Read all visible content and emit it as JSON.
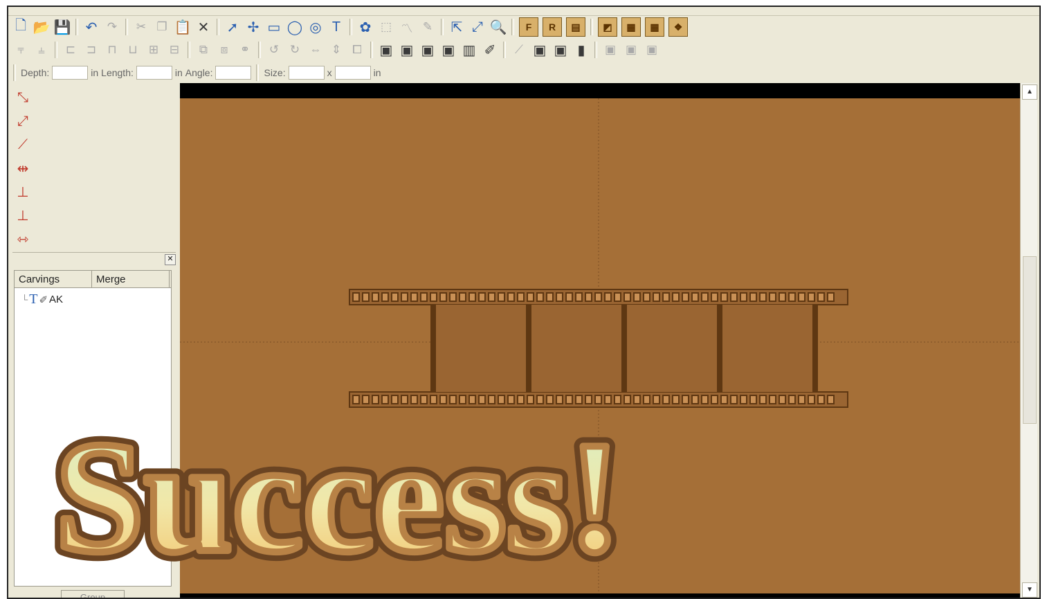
{
  "toolbar": {
    "row1": [
      {
        "name": "new-file-icon",
        "glyph": "🗋"
      },
      {
        "name": "open-folder-icon",
        "glyph": "📂"
      },
      {
        "name": "save-icon",
        "glyph": "💾"
      },
      {
        "sep": true
      },
      {
        "name": "undo-icon",
        "glyph": "↶"
      },
      {
        "name": "redo-icon",
        "glyph": "↷",
        "dim": true
      },
      {
        "sep": true
      },
      {
        "name": "cut-icon",
        "glyph": "✂",
        "dim": true
      },
      {
        "name": "copy-icon",
        "glyph": "❐",
        "dim": true
      },
      {
        "name": "paste-icon",
        "glyph": "📋",
        "dark": true
      },
      {
        "name": "delete-icon",
        "glyph": "✕",
        "dark": true
      },
      {
        "sep": true
      },
      {
        "name": "select-arrow-icon",
        "glyph": "➚"
      },
      {
        "name": "node-edit-icon",
        "glyph": "✢"
      },
      {
        "name": "rectangle-icon",
        "glyph": "▭"
      },
      {
        "name": "circle-icon",
        "glyph": "◯"
      },
      {
        "name": "spiral-icon",
        "glyph": "◎"
      },
      {
        "name": "text-tool-icon",
        "glyph": "T"
      },
      {
        "sep": true
      },
      {
        "name": "shell-icon",
        "glyph": "✿"
      },
      {
        "name": "shape-icon",
        "glyph": "⬚",
        "dim": true
      },
      {
        "name": "wave-shape-icon",
        "glyph": "〽",
        "dim": true
      },
      {
        "name": "pen-icon",
        "glyph": "✎",
        "dim": true
      },
      {
        "sep": true
      },
      {
        "name": "pointer-icon",
        "glyph": "⇱"
      },
      {
        "name": "zoom-fit-icon",
        "glyph": "⤢"
      },
      {
        "name": "zoom-icon",
        "glyph": "🔍"
      },
      {
        "sep": true
      },
      {
        "name": "front-view-icon",
        "glyph": "F",
        "boxed": true
      },
      {
        "name": "rear-view-icon",
        "glyph": "R",
        "boxed": true
      },
      {
        "name": "frame-icon",
        "glyph": "▤",
        "boxed": true
      },
      {
        "sep": true
      },
      {
        "name": "material-icon",
        "glyph": "◩",
        "boxed": true
      },
      {
        "name": "grid-icon",
        "glyph": "▦",
        "boxed": true
      },
      {
        "name": "grid-wood-icon",
        "glyph": "▦",
        "boxed": true
      },
      {
        "name": "texture-icon",
        "glyph": "❖",
        "boxed": true
      }
    ],
    "row2": [
      {
        "name": "align-top-icon",
        "glyph": "⫧",
        "dim": true
      },
      {
        "name": "align-bottom-icon",
        "glyph": "⫨",
        "dim": true
      },
      {
        "sep": true
      },
      {
        "name": "align-left-icon",
        "glyph": "⊏",
        "dim": true
      },
      {
        "name": "align-right-icon",
        "glyph": "⊐",
        "dim": true
      },
      {
        "name": "align-center-icon",
        "glyph": "⊓",
        "dim": true
      },
      {
        "name": "align-middle-icon",
        "glyph": "⊔",
        "dim": true
      },
      {
        "name": "distribute-h-icon",
        "glyph": "⊞",
        "dim": true
      },
      {
        "name": "distribute-v-icon",
        "glyph": "⊟",
        "dim": true
      },
      {
        "sep": true
      },
      {
        "name": "group-icon",
        "glyph": "⧉",
        "dim": true
      },
      {
        "name": "ungroup-icon",
        "glyph": "⧈",
        "dim": true
      },
      {
        "name": "link-icon",
        "glyph": "⚭",
        "dim": true
      },
      {
        "sep": true
      },
      {
        "name": "rotate-left-icon",
        "glyph": "↺",
        "dim": true
      },
      {
        "name": "rotate-right-icon",
        "glyph": "↻",
        "dim": true
      },
      {
        "name": "mirror-icon",
        "glyph": "⇔",
        "dim": true
      },
      {
        "name": "flip-icon",
        "glyph": "⇕",
        "dim": true
      },
      {
        "name": "combine-icon",
        "glyph": "⧠",
        "dim": true
      },
      {
        "sep": true
      },
      {
        "name": "bit-1-icon",
        "glyph": "▣",
        "dark": true
      },
      {
        "name": "bit-2-icon",
        "glyph": "▣",
        "dark": true
      },
      {
        "name": "bit-3-icon",
        "glyph": "▣",
        "dark": true
      },
      {
        "name": "bit-4-icon",
        "glyph": "▣",
        "dark": true
      },
      {
        "name": "bit-5-icon",
        "glyph": "▥",
        "dark": true
      },
      {
        "name": "brush-icon",
        "glyph": "✐",
        "dark": true
      },
      {
        "sep": true
      },
      {
        "name": "knife-icon",
        "glyph": "⟋",
        "dim": true
      },
      {
        "name": "bit-6-icon",
        "glyph": "▣",
        "dark": true
      },
      {
        "name": "bit-7-icon",
        "glyph": "▣",
        "dark": true
      },
      {
        "name": "bit-8-icon",
        "glyph": "▮",
        "dark": true
      },
      {
        "sep": true
      },
      {
        "name": "bit-9-icon",
        "glyph": "▣",
        "dim": true
      },
      {
        "name": "bit-10-icon",
        "glyph": "▣",
        "dim": true
      },
      {
        "name": "bit-11-icon",
        "glyph": "▣",
        "dim": true
      }
    ]
  },
  "fields": {
    "depth_label": "Depth:",
    "depth_unit": "in",
    "length_label": "Length:",
    "length_unit": "in",
    "angle_label": "Angle:",
    "size_label": "Size:",
    "size_separator": "x",
    "size_unit": "in"
  },
  "left_tools": [
    {
      "name": "select-node-icon",
      "glyph": "⤡"
    },
    {
      "name": "move-node-icon",
      "glyph": "⤢"
    },
    {
      "name": "draw-line-icon",
      "glyph": "⟋"
    },
    {
      "name": "transform-icon",
      "glyph": "⇹"
    },
    {
      "name": "add-point-icon",
      "glyph": "⊥"
    },
    {
      "name": "remove-point-icon",
      "glyph": "⊥"
    },
    {
      "name": "distribute-points-icon",
      "glyph": "⇿"
    }
  ],
  "panel": {
    "close_glyph": "✕",
    "tab_carvings": "Carvings",
    "tab_merge": "Merge",
    "tree_item_label": "AK",
    "group_button": "Group"
  },
  "overlay": {
    "text": "Success!"
  },
  "colors": {
    "wood": "#a56f37",
    "carving_face": "#9a6532",
    "carving_shadow": "#5e3712",
    "carving_highlight": "#c99055"
  },
  "scroll": {
    "up_glyph": "▲",
    "down_glyph": "▼"
  }
}
